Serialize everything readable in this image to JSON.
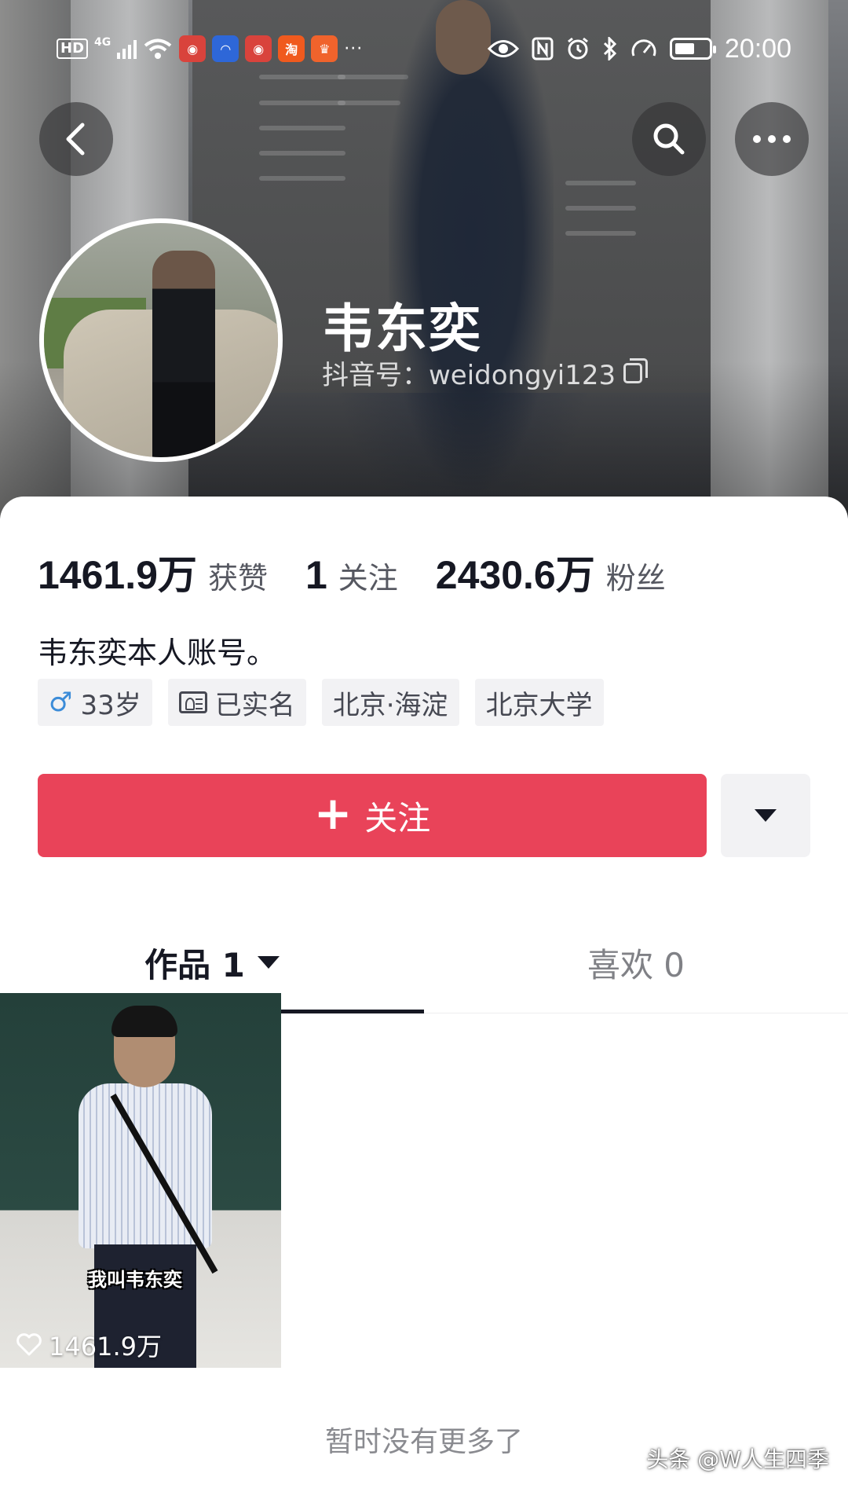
{
  "status_bar": {
    "hd": "HD",
    "network": "4G",
    "time": "20:00",
    "more_notifications": "···"
  },
  "profile": {
    "nickname": "韦东奕",
    "douyin_id": "抖音号：weidongyi123",
    "bio": "韦东奕本人账号。"
  },
  "stats": [
    {
      "value": "1461.9万",
      "label": "获赞"
    },
    {
      "value": "1",
      "label": "关注"
    },
    {
      "value": "2430.6万",
      "label": "粉丝"
    }
  ],
  "tags": {
    "age": "33岁",
    "verified": "已实名",
    "location": "北京·海淀",
    "school": "北京大学"
  },
  "actions": {
    "follow_label": "关注",
    "follow_plus": "+"
  },
  "tabs": {
    "works": "作品 1",
    "likes": "喜欢 0"
  },
  "video": {
    "caption": "我叫韦东奕",
    "likes": "1461.9万"
  },
  "footer": {
    "no_more": "暂时没有更多了",
    "watermark": "头条 @W人生四季"
  },
  "colors": {
    "accent": "#e94359",
    "text_primary": "#161823",
    "text_secondary": "#565861",
    "tag_bg": "#f2f2f4",
    "male_blue": "#3c8cd8"
  },
  "icons": [
    "back-icon",
    "search-icon",
    "more-icon",
    "copy-icon",
    "male-icon",
    "id-card-icon",
    "chevron-down-icon",
    "heart-icon"
  ]
}
